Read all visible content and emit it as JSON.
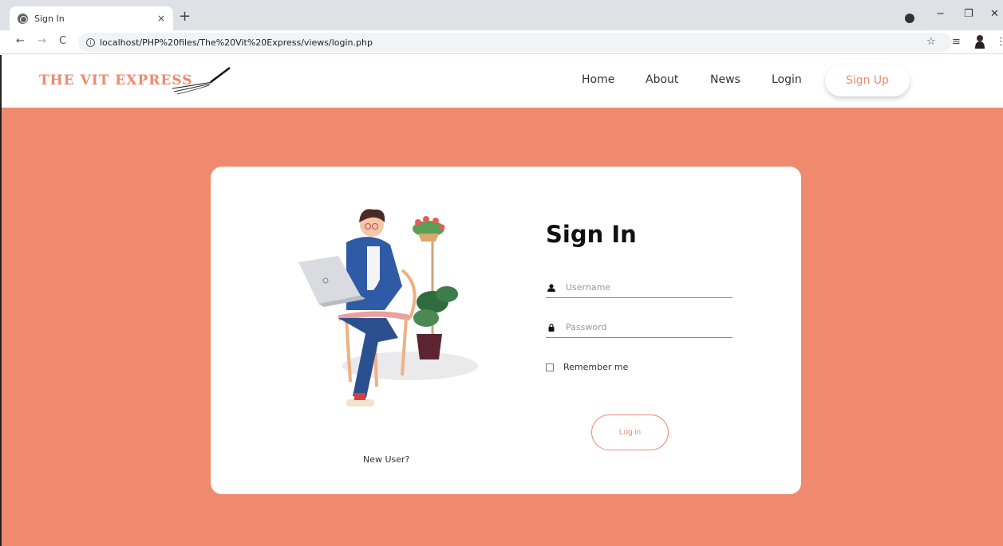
{
  "browser": {
    "tab_title": "Sign In",
    "tab_close": "×",
    "new_tab": "+",
    "url": "localhost/PHP%20files/The%20Vit%20Express/views/login.php",
    "back": "←",
    "forward": "→",
    "reload": "C",
    "star": "☆",
    "queue": "≡",
    "menu": "⋮",
    "minimize": "−",
    "restore": "❐",
    "close": "✕"
  },
  "site": {
    "logo": "THE VIT EXPRESS",
    "nav": [
      "Home",
      "About",
      "News",
      "Login"
    ],
    "signup": "Sign Up"
  },
  "login": {
    "title": "Sign In",
    "username_placeholder": "Username",
    "password_placeholder": "Password",
    "remember": "Remember me",
    "login_button": "Log in",
    "new_user": "New User?"
  },
  "colors": {
    "accent": "#ef8a6f",
    "card": "#ffffff"
  }
}
